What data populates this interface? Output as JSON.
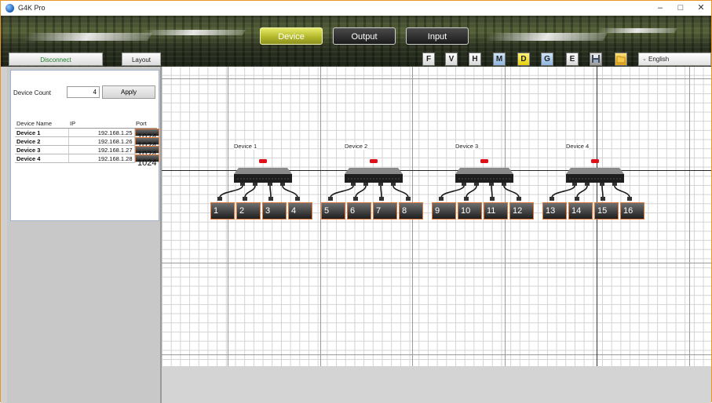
{
  "window": {
    "title": "G4K Pro",
    "controls": [
      "–",
      "□",
      "✕"
    ]
  },
  "toolbar": {
    "disconnect_label": "Disconnect",
    "layout_label": "Layout",
    "nav": [
      {
        "label": "Device",
        "active": true
      },
      {
        "label": "Output",
        "active": false
      },
      {
        "label": "Input",
        "active": false
      }
    ],
    "tools": [
      {
        "label": "F",
        "color": "#ffffff"
      },
      {
        "label": "V",
        "color": "#ffffff"
      },
      {
        "label": "H",
        "color": "#ffffff"
      },
      {
        "label": "M",
        "color": "#a8c8ec"
      },
      {
        "label": "D",
        "color": "#f1e02a"
      },
      {
        "label": "G",
        "color": "#a8c8ec"
      },
      {
        "label": "E",
        "color": "#ffffff"
      }
    ],
    "save_icon": "save-icon",
    "folder_icon": "folder-icon",
    "language": "English"
  },
  "settings": {
    "device_count_label": "Device Count",
    "device_count_value": "4",
    "apply_label": "Apply"
  },
  "device_table": {
    "headers": [
      "Device Name",
      "IP",
      "Port"
    ],
    "rows": [
      {
        "name": "Device 1",
        "ip": "192.168.1.25",
        "port": "1024"
      },
      {
        "name": "Device 2",
        "ip": "192.168.1.26",
        "port": "1024"
      },
      {
        "name": "Device 3",
        "ip": "192.168.1.27",
        "port": "1024"
      },
      {
        "name": "Device 4",
        "ip": "192.168.1.28",
        "port": "1024"
      }
    ]
  },
  "layout_canvas": {
    "devices": [
      {
        "label": "Device 1",
        "outputs": [
          "1",
          "2",
          "3",
          "4"
        ]
      },
      {
        "label": "Device 2",
        "outputs": [
          "5",
          "6",
          "7",
          "8"
        ]
      },
      {
        "label": "Device 3",
        "outputs": [
          "9",
          "10",
          "11",
          "12"
        ]
      },
      {
        "label": "Device 4",
        "outputs": [
          "13",
          "14",
          "15",
          "16"
        ]
      }
    ],
    "led_color": "#e0101a",
    "port_border_color": "#e07a3a"
  }
}
